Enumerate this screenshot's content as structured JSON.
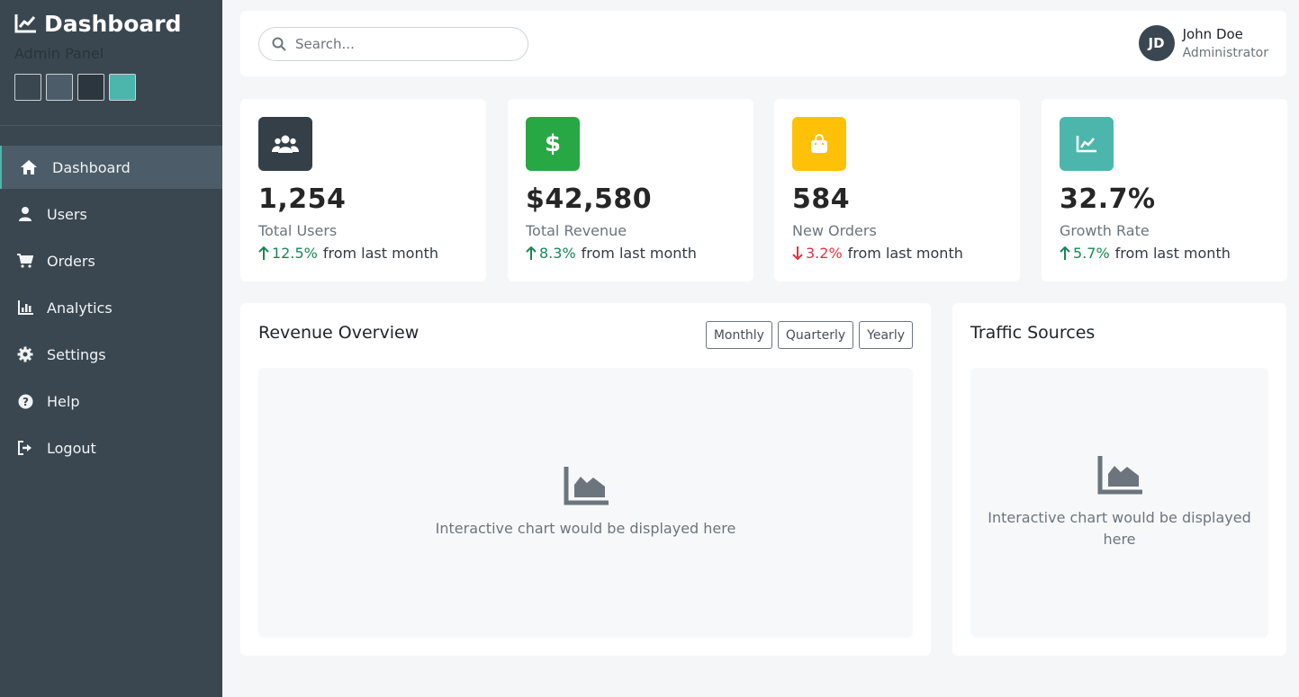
{
  "sidebar": {
    "brand_title": "Dashboard",
    "brand_subtitle": "Admin Panel",
    "swatches": [
      "#3a4750",
      "#4c5d69",
      "#2c363e",
      "#4db6ac"
    ],
    "items": [
      {
        "label": "Dashboard",
        "icon": "home-icon",
        "active": true
      },
      {
        "label": "Users",
        "icon": "user-icon"
      },
      {
        "label": "Orders",
        "icon": "cart-icon"
      },
      {
        "label": "Analytics",
        "icon": "bar-chart-icon"
      },
      {
        "label": "Settings",
        "icon": "gear-icon"
      },
      {
        "label": "Help",
        "icon": "question-icon"
      },
      {
        "label": "Logout",
        "icon": "logout-icon"
      }
    ]
  },
  "header": {
    "search_placeholder": "Search...",
    "user": {
      "initials": "JD",
      "name": "John Doe",
      "role": "Administrator"
    }
  },
  "stats": [
    {
      "value": "1,254",
      "label": "Total Users",
      "change": "12.5%",
      "direction": "up",
      "suffix": "from last month",
      "icon": "users-icon",
      "color": "#343f48"
    },
    {
      "value": "$42,580",
      "label": "Total Revenue",
      "change": "8.3%",
      "direction": "up",
      "suffix": "from last month",
      "icon": "dollar-icon",
      "color": "#28a745"
    },
    {
      "value": "584",
      "label": "New Orders",
      "change": "3.2%",
      "direction": "down",
      "suffix": "from last month",
      "icon": "shopping-bag-icon",
      "color": "#ffc107"
    },
    {
      "value": "32.7%",
      "label": "Growth Rate",
      "change": "5.7%",
      "direction": "up",
      "suffix": "from last month",
      "icon": "line-chart-icon",
      "color": "#4db6ac"
    }
  ],
  "revenue_panel": {
    "title": "Revenue Overview",
    "buttons": [
      "Monthly",
      "Quarterly",
      "Yearly"
    ],
    "placeholder": "Interactive chart would be displayed here"
  },
  "traffic_panel": {
    "title": "Traffic Sources",
    "placeholder": "Interactive chart would be displayed here"
  }
}
